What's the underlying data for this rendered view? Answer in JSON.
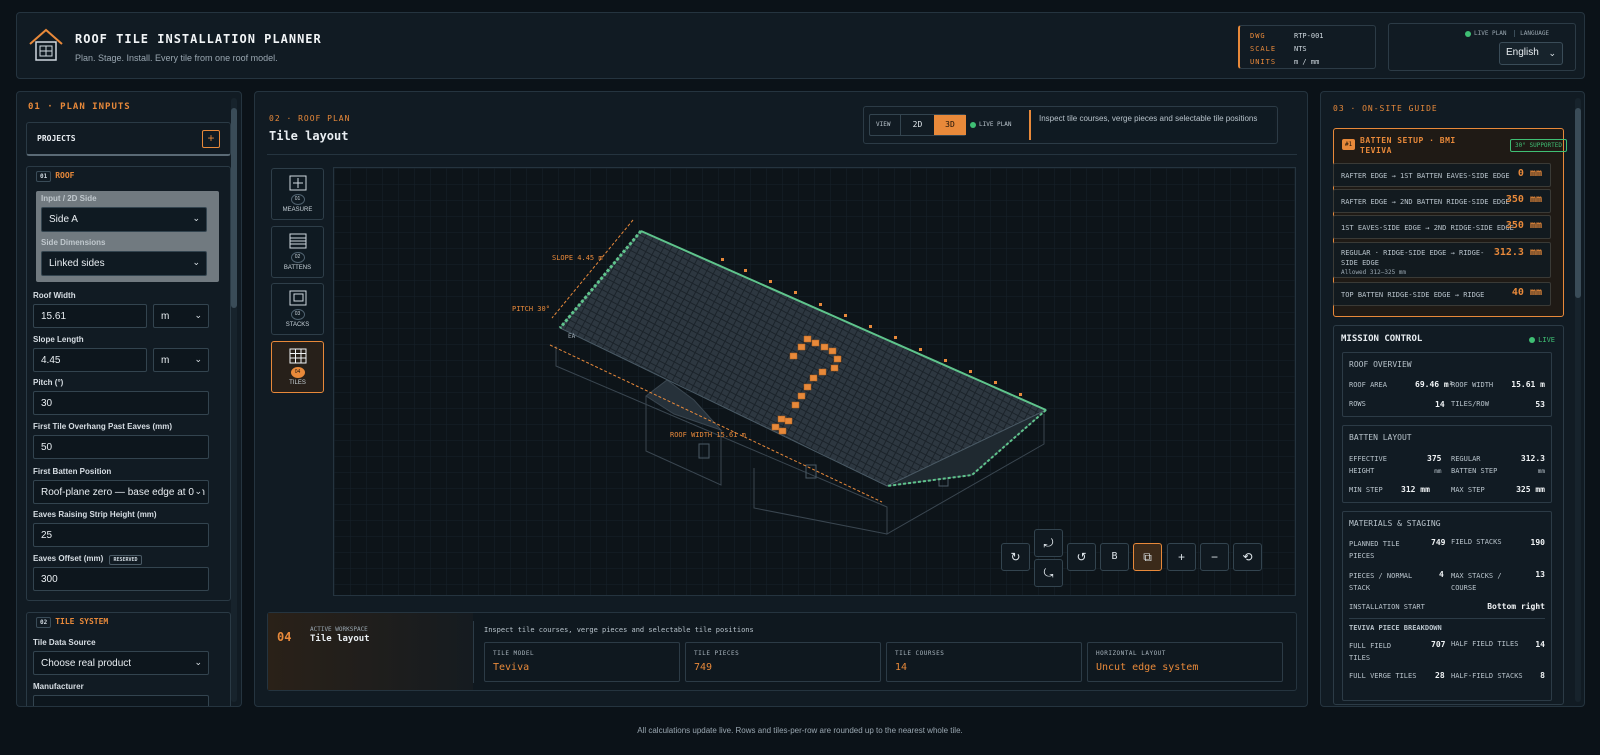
{
  "header": {
    "title": "ROOF TILE INSTALLATION PLANNER",
    "subtitle": "Plan. Stage. Install. Every tile from one roof model.",
    "meta": [
      {
        "key": "DWG",
        "value": "RTP-001"
      },
      {
        "key": "SCALE",
        "value": "NTS"
      },
      {
        "key": "UNITS",
        "value": "m / mm"
      }
    ],
    "live_label": "LIVE PLAN",
    "language_label": "LANGUAGE",
    "language_value": "English"
  },
  "left": {
    "section_title": "01 · PLAN INPUTS",
    "projects_label": "PROJECTS",
    "projects_add": "+",
    "roof": {
      "num": "01",
      "title": "ROOF",
      "input_side_label": "Input / 2D Side",
      "input_side_value": "Side A",
      "side_dims_label": "Side Dimensions",
      "side_dims_value": "Linked sides",
      "roof_width_label": "Roof Width",
      "roof_width_value": "15.61",
      "roof_width_unit": "m",
      "slope_length_label": "Slope Length",
      "slope_length_value": "4.45",
      "slope_length_unit": "m",
      "pitch_label": "Pitch (°)",
      "pitch_value": "30",
      "overhang_label": "First Tile Overhang Past Eaves (mm)",
      "overhang_value": "50",
      "first_batten_label": "First Batten Position",
      "first_batten_value": "Roof-plane zero — base edge at 0 m",
      "eaves_strip_label": "Eaves Raising Strip Height (mm)",
      "eaves_strip_value": "25",
      "eaves_offset_label": "Eaves Offset (mm)",
      "eaves_offset_badge": "RESERVED",
      "eaves_offset_value": "300"
    },
    "tile_system": {
      "num": "02",
      "title": "TILE SYSTEM",
      "source_label": "Tile Data Source",
      "source_value": "Choose real product",
      "manufacturer_label": "Manufacturer"
    }
  },
  "center": {
    "section_title": "02 · ROOF PLAN",
    "title": "Tile layout",
    "view_label": "VIEW",
    "view_2d": "2D",
    "view_3d": "3D",
    "live_label": "LIVE PLAN",
    "hint": "Inspect tile courses, verge pieces and selectable tile positions",
    "tools": [
      {
        "num": "01",
        "label": "MEASURE"
      },
      {
        "num": "02",
        "label": "BATTENS"
      },
      {
        "num": "03",
        "label": "STACKS"
      },
      {
        "num": "04",
        "label": "TILES"
      }
    ],
    "dims": {
      "slope": "SLOPE 4.45 m",
      "pitch": "PITCH 30°",
      "width": "ROOF WIDTH 15.61 m",
      "eaves": "EA"
    },
    "controls": {
      "b_label": "B"
    },
    "workspace": {
      "num": "04",
      "active_label": "ACTIVE WORKSPACE",
      "name": "Tile layout",
      "description": "Inspect tile courses, verge pieces and selectable tile positions",
      "stats": [
        {
          "key": "TILE MODEL",
          "value": "Teviva"
        },
        {
          "key": "TILE PIECES",
          "value": "749"
        },
        {
          "key": "TILE COURSES",
          "value": "14"
        },
        {
          "key": "HORIZONTAL LAYOUT",
          "value": "Uncut edge system"
        }
      ]
    }
  },
  "right": {
    "section_title": "03 · ON-SITE GUIDE",
    "batten": {
      "num": "#1",
      "title": "BATTEN SETUP · BMI TEVIVA",
      "badge": "30° SUPPORTED",
      "rows": [
        {
          "label": "RAFTER EDGE → 1ST BATTEN EAVES-SIDE EDGE",
          "value": "0 mm"
        },
        {
          "label": "RAFTER EDGE → 2ND BATTEN RIDGE-SIDE EDGE",
          "value": "350 mm"
        },
        {
          "label": "1ST EAVES-SIDE EDGE → 2ND RIDGE-SIDE EDGE",
          "value": "350 mm"
        },
        {
          "label": "REGULAR · RIDGE-SIDE EDGE → RIDGE-SIDE EDGE",
          "value": "312.3 mm",
          "note": "Allowed 312–325 mm"
        },
        {
          "label": "TOP BATTEN RIDGE-SIDE EDGE → RIDGE",
          "value": "40 mm"
        }
      ]
    },
    "mission": {
      "title": "MISSION CONTROL",
      "live": "LIVE",
      "overview": {
        "title": "ROOF OVERVIEW",
        "roof_area_k": "ROOF AREA",
        "roof_area_v": "69.46 m²",
        "roof_width_k": "ROOF WIDTH",
        "roof_width_v": "15.61 m",
        "rows_k": "ROWS",
        "rows_v": "14",
        "tiles_row_k": "TILES/ROW",
        "tiles_row_v": "53"
      },
      "batten_layout": {
        "title": "BATTEN LAYOUT",
        "eff_k1": "EFFECTIVE",
        "eff_k2": "HEIGHT",
        "eff_v": "375",
        "eff_u": "mm",
        "reg_k1": "REGULAR",
        "reg_k2": "BATTEN STEP",
        "reg_v": "312.3",
        "reg_u": "mm",
        "min_k": "MIN STEP",
        "min_v": "312 mm",
        "max_k": "MAX STEP",
        "max_v": "325 mm"
      },
      "materials": {
        "title": "MATERIALS & STAGING",
        "planned_k1": "PLANNED TILE",
        "planned_k2": "PIECES",
        "planned_v": "749",
        "field_k": "FIELD STACKS",
        "field_v": "190",
        "pps_k1": "PIECES / NORMAL",
        "pps_k2": "STACK",
        "pps_v": "4",
        "max_k1": "MAX STACKS /",
        "max_k2": "COURSE",
        "max_v": "13",
        "start_k": "INSTALLATION START",
        "start_v": "Bottom right",
        "breakdown_title": "TEVIVA PIECE BREAKDOWN",
        "ff_k1": "FULL FIELD",
        "ff_k2": "TILES",
        "ff_v": "707",
        "hf_k": "HALF FIELD TILES",
        "hf_v": "14",
        "fv_k": "FULL VERGE TILES",
        "fv_v": "28",
        "hs_k": "HALF-FIELD STACKS",
        "hs_v": "8"
      }
    }
  },
  "footer": "All calculations update live. Rows and tiles-per-row are rounded up to the nearest whole tile.",
  "colors": {
    "accent": "#e8893a",
    "live": "#3fbf74",
    "verge": "#5fc48c"
  }
}
